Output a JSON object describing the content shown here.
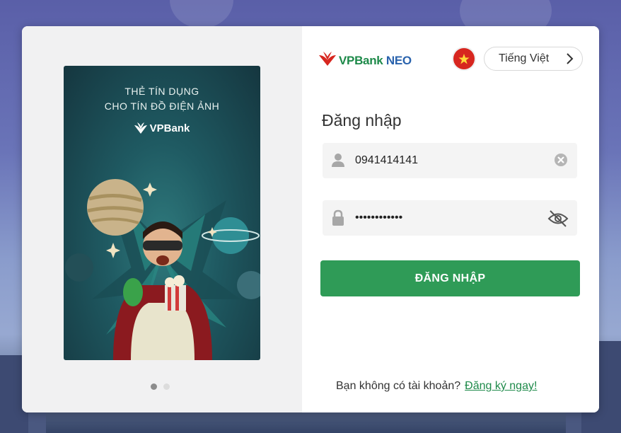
{
  "brand": {
    "name": "VPBank",
    "suffix": "NEO"
  },
  "language": {
    "label": "Tiếng Việt"
  },
  "login": {
    "title": "Đăng nhập",
    "username_value": "0941414141",
    "password_value": "••••••••••••",
    "submit_label": "ĐĂNG NHẬP"
  },
  "signup": {
    "prompt": "Bạn không có tài khoản?",
    "link_label": "Đăng ký ngay!"
  },
  "promo": {
    "line1": "THẺ TÍN DỤNG",
    "line2": "CHO TÍN ĐỒ ĐIỆN ẢNH",
    "logo_text": "VPBank"
  },
  "carousel": {
    "count": 2,
    "active": 1
  },
  "colors": {
    "primary_green": "#2f9b57",
    "link_green": "#1e8a4a",
    "neo_blue": "#2a63ad",
    "flag_red": "#d7261f"
  }
}
